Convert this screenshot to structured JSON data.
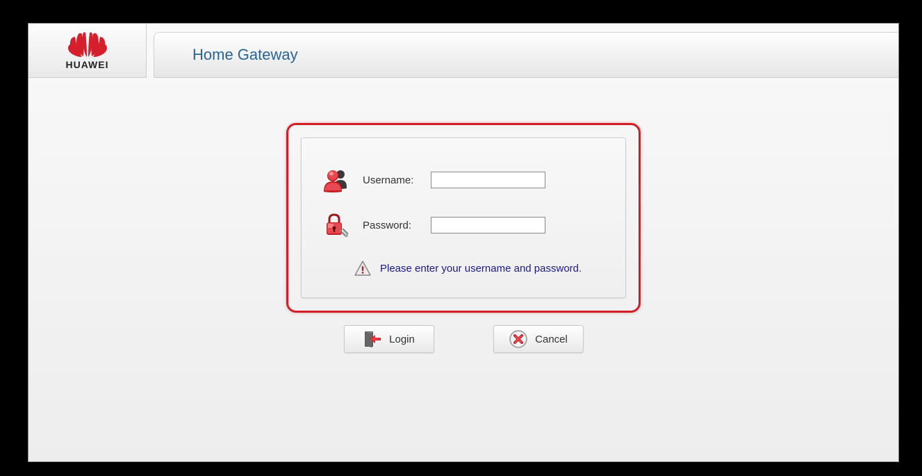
{
  "brand": {
    "name": "HUAWEI"
  },
  "header": {
    "title": "Home Gateway"
  },
  "login_form": {
    "username_label": "Username:",
    "username_value": "",
    "password_label": "Password:",
    "password_value": "",
    "hint_message": "Please enter your username and password."
  },
  "buttons": {
    "login_label": "Login",
    "cancel_label": "Cancel"
  }
}
